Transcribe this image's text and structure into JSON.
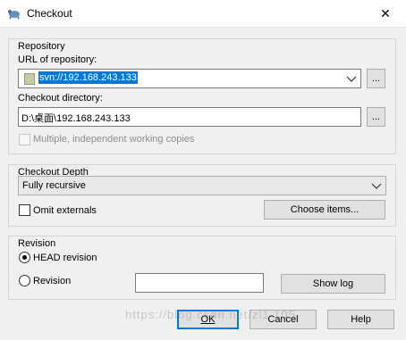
{
  "window": {
    "title": "Checkout",
    "close_glyph": "✕"
  },
  "repository": {
    "group_title": "Repository",
    "url_label": "URL of repository:",
    "url_value": "svn://192.168.243.133",
    "browse_label": "...",
    "checkout_dir_label": "Checkout directory:",
    "checkout_dir_value": "D:\\桌面\\192.168.243.133",
    "dir_browse_label": "...",
    "multiple_copies_label": "Multiple, independent working copies"
  },
  "depth": {
    "group_title": "Checkout Depth",
    "selected": "Fully recursive",
    "omit_externals_label": "Omit externals",
    "choose_items_label": "Choose items..."
  },
  "revision": {
    "group_title": "Revision",
    "head_label": "HEAD revision",
    "revision_label": "Revision",
    "revision_value": "",
    "show_log_label": "Show log"
  },
  "buttons": {
    "ok": "OK",
    "cancel": "Cancel",
    "help": "Help"
  },
  "watermark": "https://blog.csdn.net/zl1 105",
  "colors": {
    "accent": "#0078d7",
    "background": "#f0f0f0"
  }
}
